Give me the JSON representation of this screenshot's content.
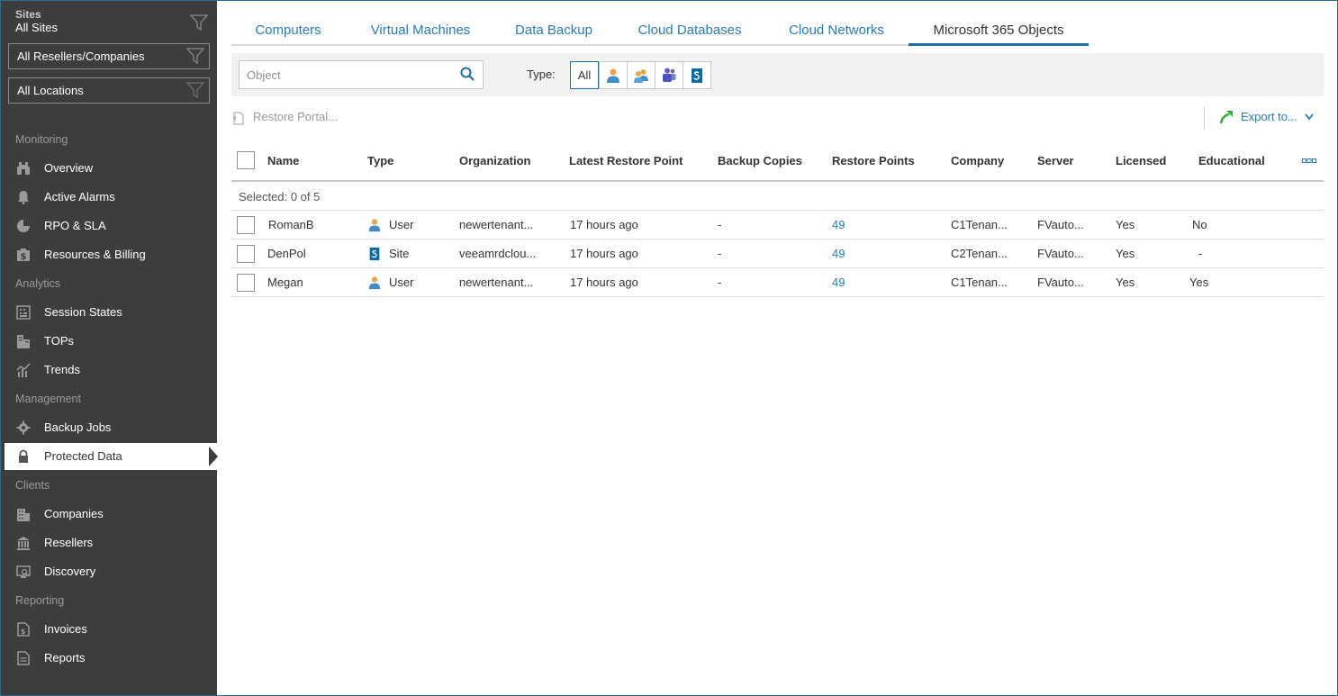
{
  "sidebar": {
    "sites_label": "Sites",
    "sites_value": "All Sites",
    "resellers_dropdown": "All Resellers/Companies",
    "locations_dropdown": "All Locations",
    "groups": {
      "monitoring": "Monitoring",
      "analytics": "Analytics",
      "management": "Management",
      "clients": "Clients",
      "reporting": "Reporting"
    },
    "items": {
      "overview": "Overview",
      "active_alarms": "Active Alarms",
      "rpo_sla": "RPO & SLA",
      "resources_billing": "Resources & Billing",
      "session_states": "Session States",
      "tops": "TOPs",
      "trends": "Trends",
      "backup_jobs": "Backup Jobs",
      "protected_data": "Protected Data",
      "companies": "Companies",
      "resellers": "Resellers",
      "discovery": "Discovery",
      "invoices": "Invoices",
      "reports": "Reports"
    }
  },
  "tabs": {
    "computers": "Computers",
    "virtual_machines": "Virtual Machines",
    "data_backup": "Data Backup",
    "cloud_databases": "Cloud Databases",
    "cloud_networks": "Cloud Networks",
    "m365_objects": "Microsoft 365 Objects"
  },
  "filter": {
    "search_placeholder": "Object",
    "type_label": "Type:",
    "type_all": "All"
  },
  "actions": {
    "restore_portal": "Restore Portal...",
    "export": "Export to..."
  },
  "table": {
    "headers": {
      "name": "Name",
      "type": "Type",
      "organization": "Organization",
      "latest_restore_point": "Latest Restore Point",
      "backup_copies": "Backup Copies",
      "restore_points": "Restore Points",
      "company": "Company",
      "server": "Server",
      "licensed": "Licensed",
      "educational": "Educational"
    },
    "selected_text": "Selected: 0 of 5",
    "rows": [
      {
        "name": "RomanB",
        "type": "User",
        "organization": "newertenant...",
        "latest": "17 hours ago",
        "copies": "-",
        "points": "49",
        "company": "C1Tenan...",
        "server": "FVauto...",
        "licensed": "Yes",
        "educational": "No"
      },
      {
        "name": "DenPol",
        "type": "Site",
        "organization": "veeamrdclou...",
        "latest": "17 hours ago",
        "copies": "-",
        "points": "49",
        "company": "C2Tenan...",
        "server": "FVauto...",
        "licensed": "Yes",
        "educational": "-"
      },
      {
        "name": "Megan",
        "type": "User",
        "organization": "newertenant...",
        "latest": "17 hours ago",
        "copies": "-",
        "points": "49",
        "company": "C1Tenan...",
        "server": "FVauto...",
        "licensed": "Yes",
        "educational": "Yes"
      }
    ]
  }
}
